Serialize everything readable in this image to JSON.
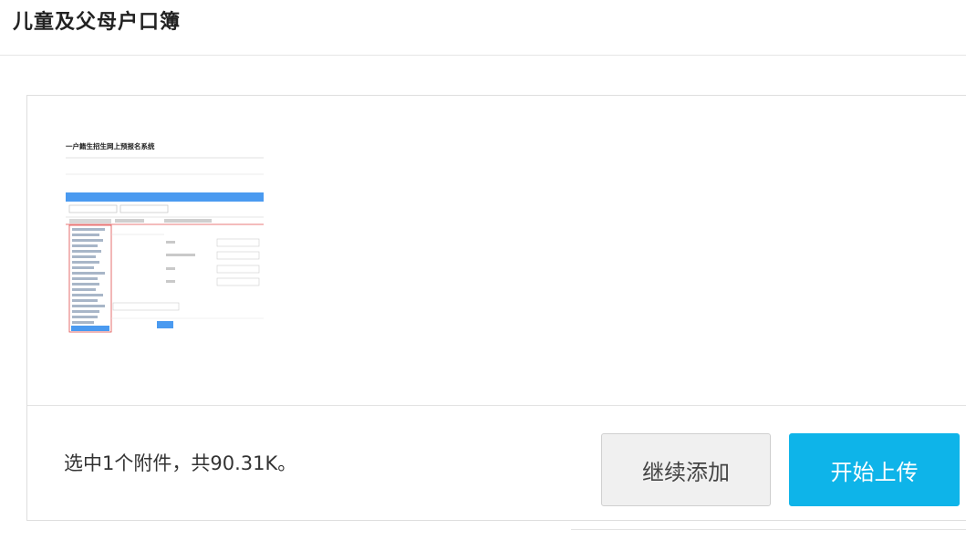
{
  "page": {
    "title": "儿童及父母户口簿"
  },
  "preview": {
    "file_thumbnail": {
      "heading": "一户籍生招生网上预报名系统",
      "items": [
        "关系证明材料",
        "户籍所在地证明",
        "父亲户籍"
      ]
    }
  },
  "footer": {
    "status": "选中1个附件，共90.31K。",
    "continue_label": "继续添加",
    "upload_label": "开始上传"
  },
  "colors": {
    "accent": "#0eb4e9",
    "secondary_button_bg": "#f0f0f0",
    "border": "#dedede"
  }
}
